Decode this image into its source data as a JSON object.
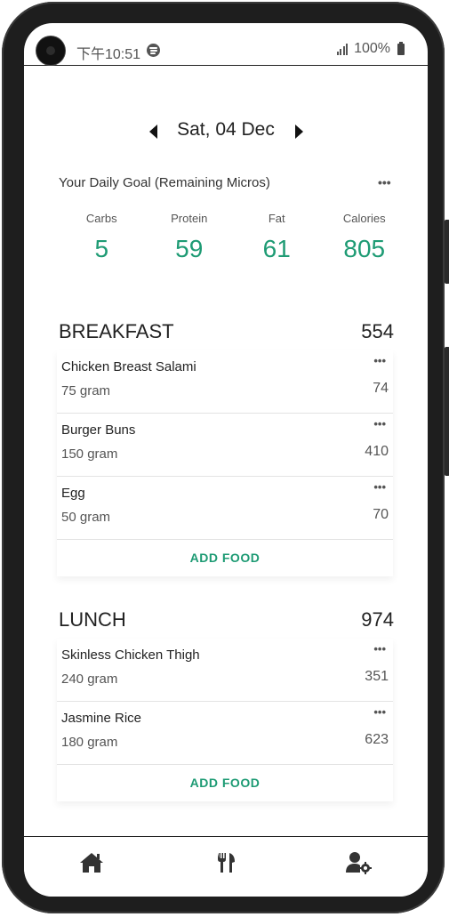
{
  "status_bar": {
    "time": "下午10:51",
    "battery": "100%"
  },
  "date_nav": {
    "date": "Sat, 04 Dec"
  },
  "daily_goal": {
    "title": "Your Daily Goal (Remaining Micros)",
    "menu": "•••",
    "macros": [
      {
        "label": "Carbs",
        "value": "5"
      },
      {
        "label": "Protein",
        "value": "59"
      },
      {
        "label": "Fat",
        "value": "61"
      },
      {
        "label": "Calories",
        "value": "805"
      }
    ]
  },
  "meals": [
    {
      "title": "BREAKFAST",
      "total": "554",
      "items": [
        {
          "name": "Chicken Breast Salami",
          "qty": "75 gram",
          "calories": "74",
          "menu": "•••"
        },
        {
          "name": "Burger Buns",
          "qty": "150 gram",
          "calories": "410",
          "menu": "•••"
        },
        {
          "name": "Egg",
          "qty": "50 gram",
          "calories": "70",
          "menu": "•••"
        }
      ],
      "add_label": "ADD FOOD"
    },
    {
      "title": "LUNCH",
      "total": "974",
      "items": [
        {
          "name": "Skinless Chicken Thigh",
          "qty": "240 gram",
          "calories": "351",
          "menu": "•••"
        },
        {
          "name": "Jasmine Rice",
          "qty": "180 gram",
          "calories": "623",
          "menu": "•••"
        }
      ],
      "add_label": "ADD FOOD"
    }
  ],
  "bottom_nav": {
    "items": [
      {
        "icon": "home-icon"
      },
      {
        "icon": "fork-knife-icon"
      },
      {
        "icon": "user-settings-icon"
      }
    ]
  },
  "colors": {
    "accent": "#1e9b74",
    "text": "#222222",
    "muted": "#555555",
    "divider": "#e3e3e3"
  }
}
